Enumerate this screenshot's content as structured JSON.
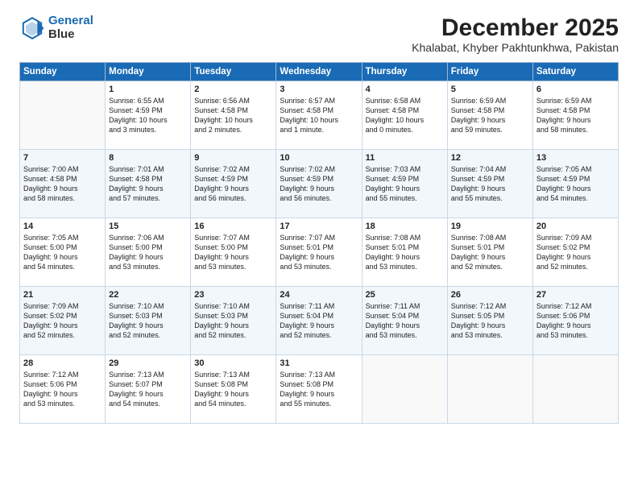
{
  "logo": {
    "line1": "General",
    "line2": "Blue"
  },
  "title": "December 2025",
  "subtitle": "Khalabat, Khyber Pakhtunkhwa, Pakistan",
  "days_of_week": [
    "Sunday",
    "Monday",
    "Tuesday",
    "Wednesday",
    "Thursday",
    "Friday",
    "Saturday"
  ],
  "weeks": [
    [
      {
        "day": "",
        "content": ""
      },
      {
        "day": "1",
        "content": "Sunrise: 6:55 AM\nSunset: 4:59 PM\nDaylight: 10 hours\nand 3 minutes."
      },
      {
        "day": "2",
        "content": "Sunrise: 6:56 AM\nSunset: 4:58 PM\nDaylight: 10 hours\nand 2 minutes."
      },
      {
        "day": "3",
        "content": "Sunrise: 6:57 AM\nSunset: 4:58 PM\nDaylight: 10 hours\nand 1 minute."
      },
      {
        "day": "4",
        "content": "Sunrise: 6:58 AM\nSunset: 4:58 PM\nDaylight: 10 hours\nand 0 minutes."
      },
      {
        "day": "5",
        "content": "Sunrise: 6:59 AM\nSunset: 4:58 PM\nDaylight: 9 hours\nand 59 minutes."
      },
      {
        "day": "6",
        "content": "Sunrise: 6:59 AM\nSunset: 4:58 PM\nDaylight: 9 hours\nand 58 minutes."
      }
    ],
    [
      {
        "day": "7",
        "content": "Sunrise: 7:00 AM\nSunset: 4:58 PM\nDaylight: 9 hours\nand 58 minutes."
      },
      {
        "day": "8",
        "content": "Sunrise: 7:01 AM\nSunset: 4:58 PM\nDaylight: 9 hours\nand 57 minutes."
      },
      {
        "day": "9",
        "content": "Sunrise: 7:02 AM\nSunset: 4:59 PM\nDaylight: 9 hours\nand 56 minutes."
      },
      {
        "day": "10",
        "content": "Sunrise: 7:02 AM\nSunset: 4:59 PM\nDaylight: 9 hours\nand 56 minutes."
      },
      {
        "day": "11",
        "content": "Sunrise: 7:03 AM\nSunset: 4:59 PM\nDaylight: 9 hours\nand 55 minutes."
      },
      {
        "day": "12",
        "content": "Sunrise: 7:04 AM\nSunset: 4:59 PM\nDaylight: 9 hours\nand 55 minutes."
      },
      {
        "day": "13",
        "content": "Sunrise: 7:05 AM\nSunset: 4:59 PM\nDaylight: 9 hours\nand 54 minutes."
      }
    ],
    [
      {
        "day": "14",
        "content": "Sunrise: 7:05 AM\nSunset: 5:00 PM\nDaylight: 9 hours\nand 54 minutes."
      },
      {
        "day": "15",
        "content": "Sunrise: 7:06 AM\nSunset: 5:00 PM\nDaylight: 9 hours\nand 53 minutes."
      },
      {
        "day": "16",
        "content": "Sunrise: 7:07 AM\nSunset: 5:00 PM\nDaylight: 9 hours\nand 53 minutes."
      },
      {
        "day": "17",
        "content": "Sunrise: 7:07 AM\nSunset: 5:01 PM\nDaylight: 9 hours\nand 53 minutes."
      },
      {
        "day": "18",
        "content": "Sunrise: 7:08 AM\nSunset: 5:01 PM\nDaylight: 9 hours\nand 53 minutes."
      },
      {
        "day": "19",
        "content": "Sunrise: 7:08 AM\nSunset: 5:01 PM\nDaylight: 9 hours\nand 52 minutes."
      },
      {
        "day": "20",
        "content": "Sunrise: 7:09 AM\nSunset: 5:02 PM\nDaylight: 9 hours\nand 52 minutes."
      }
    ],
    [
      {
        "day": "21",
        "content": "Sunrise: 7:09 AM\nSunset: 5:02 PM\nDaylight: 9 hours\nand 52 minutes."
      },
      {
        "day": "22",
        "content": "Sunrise: 7:10 AM\nSunset: 5:03 PM\nDaylight: 9 hours\nand 52 minutes."
      },
      {
        "day": "23",
        "content": "Sunrise: 7:10 AM\nSunset: 5:03 PM\nDaylight: 9 hours\nand 52 minutes."
      },
      {
        "day": "24",
        "content": "Sunrise: 7:11 AM\nSunset: 5:04 PM\nDaylight: 9 hours\nand 52 minutes."
      },
      {
        "day": "25",
        "content": "Sunrise: 7:11 AM\nSunset: 5:04 PM\nDaylight: 9 hours\nand 53 minutes."
      },
      {
        "day": "26",
        "content": "Sunrise: 7:12 AM\nSunset: 5:05 PM\nDaylight: 9 hours\nand 53 minutes."
      },
      {
        "day": "27",
        "content": "Sunrise: 7:12 AM\nSunset: 5:06 PM\nDaylight: 9 hours\nand 53 minutes."
      }
    ],
    [
      {
        "day": "28",
        "content": "Sunrise: 7:12 AM\nSunset: 5:06 PM\nDaylight: 9 hours\nand 53 minutes."
      },
      {
        "day": "29",
        "content": "Sunrise: 7:13 AM\nSunset: 5:07 PM\nDaylight: 9 hours\nand 54 minutes."
      },
      {
        "day": "30",
        "content": "Sunrise: 7:13 AM\nSunset: 5:08 PM\nDaylight: 9 hours\nand 54 minutes."
      },
      {
        "day": "31",
        "content": "Sunrise: 7:13 AM\nSunset: 5:08 PM\nDaylight: 9 hours\nand 55 minutes."
      },
      {
        "day": "",
        "content": ""
      },
      {
        "day": "",
        "content": ""
      },
      {
        "day": "",
        "content": ""
      }
    ]
  ]
}
